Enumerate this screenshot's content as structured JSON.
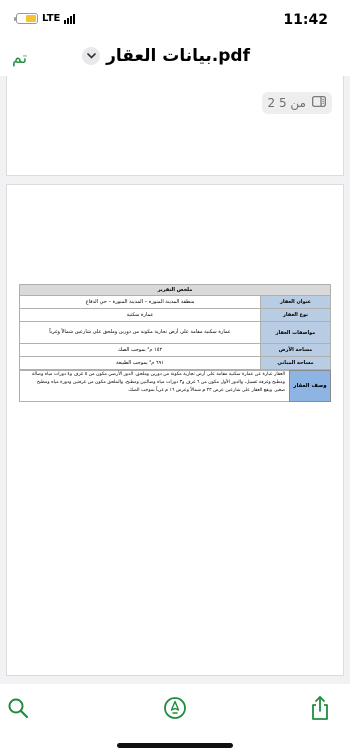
{
  "status_bar": {
    "time": "11:42",
    "network": "LTE",
    "battery_level": 0.55,
    "battery_color": "#f4c430"
  },
  "nav": {
    "done_label": "تم",
    "title": "بيانات العقار.pdf",
    "title_menu_icon": "chevron-down-icon",
    "accent_color": "#1e8e3e"
  },
  "page_counter": {
    "text": "2 من 5",
    "icon": "sidebar-icon"
  },
  "report": {
    "heading": "ملخص التقرير",
    "rows": [
      {
        "label": "عنوان العقار",
        "value": "منطقة المدينة المنورة – المدينة المنورة – حي الدفاع"
      },
      {
        "label": "نوع العقار",
        "value": "عمارة سكنية"
      },
      {
        "label": "مواصفات العقار",
        "value": "عمارة سكنية مقامة على أرض تجارية مكونة من دورين وملحق على شارعين شمالاً وغرباً"
      },
      {
        "label": "مساحة الأرض",
        "value": "١٥٢ م² بموجب الصك"
      },
      {
        "label": "مساحة المباني",
        "value": "٦٩١ م² بموجب الطبيعة"
      }
    ],
    "description_label": "وصف العقار",
    "description": "العقار عبارة عن عمارة سكنية مقامة على أرض تجارية مكونة من دورين وملحق. الدور الأرضي مكون من ٥ غرف و٤ دورات مياه وصالة ومطبخ وغرفة غسيل، والدور الأول مكون من ٦ غرف و٣ دورات مياه وصالتين ومطبخ، والملحق مكون من غرفتين ودورة مياه ومطبخ صغير. ويقع العقار على شارعين عرض ٢٣ م شمالاً وعرض ١٦ م غرباً بموجب الصك.",
    "header_color": "#d9d9d9",
    "label_color": "#b8cce4",
    "description_label_color": "#8db4e2"
  },
  "toolbar": {
    "search_icon": "search-icon",
    "markup_icon": "markup-pen-icon",
    "share_icon": "share-icon"
  }
}
